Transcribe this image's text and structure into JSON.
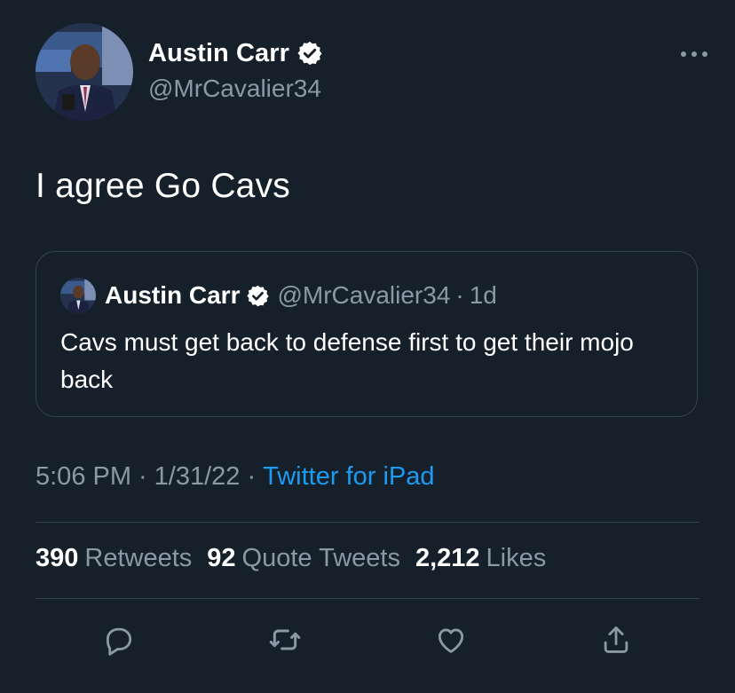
{
  "author": {
    "display_name": "Austin Carr",
    "handle": "@MrCavalier34",
    "verified_icon": "verified-badge-icon",
    "avatar_icon": "avatar"
  },
  "more_icon": "more-options-icon",
  "tweet": {
    "text": "I agree Go Cavs"
  },
  "quoted_tweet": {
    "display_name": "Austin Carr",
    "handle": "@MrCavalier34",
    "dot": "·",
    "time": "1d",
    "text": "Cavs must get back to defense first to get their mojo back"
  },
  "meta": {
    "time": "5:06 PM",
    "sep1": "·",
    "date": "1/31/22",
    "sep2": "·",
    "source": "Twitter for iPad"
  },
  "stats": {
    "retweets_count": "390",
    "retweets_label": "Retweets",
    "quotes_count": "92",
    "quotes_label": "Quote Tweets",
    "likes_count": "2,212",
    "likes_label": "Likes"
  },
  "actions": [
    "reply-icon",
    "retweet-icon",
    "like-icon",
    "share-icon"
  ],
  "colors": {
    "background": "#15202b",
    "text": "#ffffff",
    "muted": "#8b98a5",
    "accent": "#1d9bf0",
    "border": "#38444d"
  }
}
